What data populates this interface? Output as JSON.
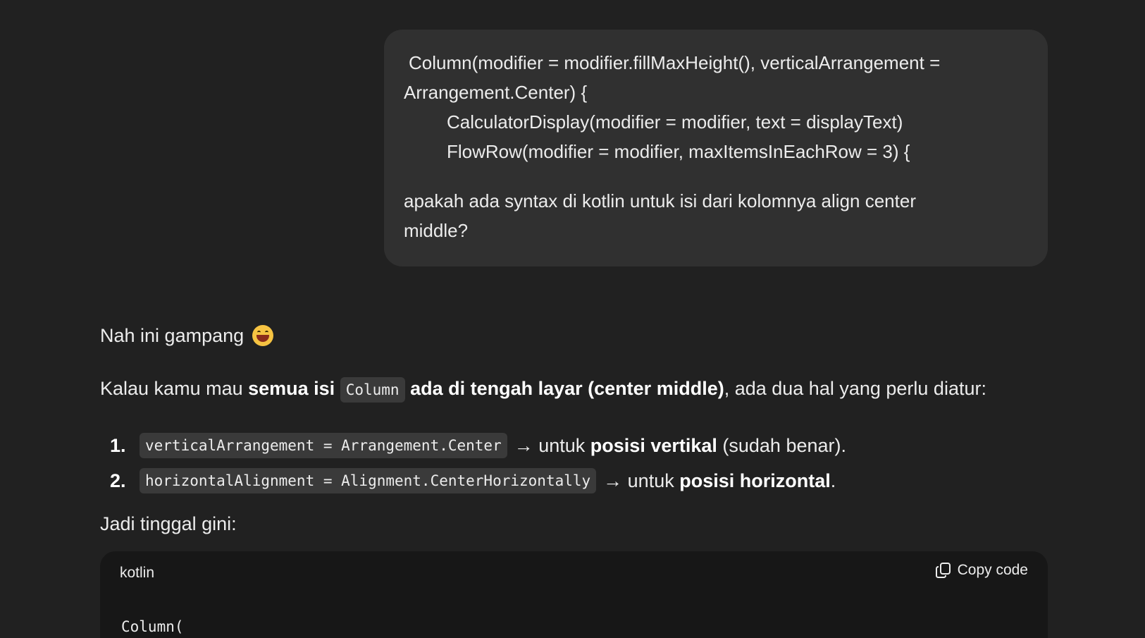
{
  "user_message": {
    "line1": "Column(modifier = modifier.fillMaxHeight(), verticalArrangement =",
    "line2": "Arrangement.Center) {",
    "line3": "CalculatorDisplay(modifier = modifier, text = displayText)",
    "line4": "FlowRow(modifier = modifier, maxItemsInEachRow = 3) {",
    "question1": "apakah ada syntax di kotlin untuk isi dari kolomnya align center",
    "question2": "middle?"
  },
  "assistant": {
    "greeting": "Nah ini gampang",
    "greeting_emoji": "grinning-squinting-face",
    "intro": {
      "t1": "Kalau kamu mau ",
      "b1": "semua isi",
      "code": "Column",
      "b2": "ada di tengah layar (center middle)",
      "t2": ", ada dua hal yang perlu diatur:"
    },
    "list": [
      {
        "num": "1.",
        "code": "verticalArrangement = Arrangement.Center",
        "t1": "→ untuk ",
        "b1": "posisi vertikal",
        "t2": " (sudah benar)."
      },
      {
        "num": "2.",
        "code": "horizontalAlignment = Alignment.CenterHorizontally",
        "t1": "→ untuk ",
        "b1": "posisi horizontal",
        "t2": "."
      }
    ],
    "after_list": "Jadi tinggal gini:"
  },
  "code_block": {
    "language": "kotlin",
    "copy_label": "Copy code",
    "first_line": "Column("
  }
}
